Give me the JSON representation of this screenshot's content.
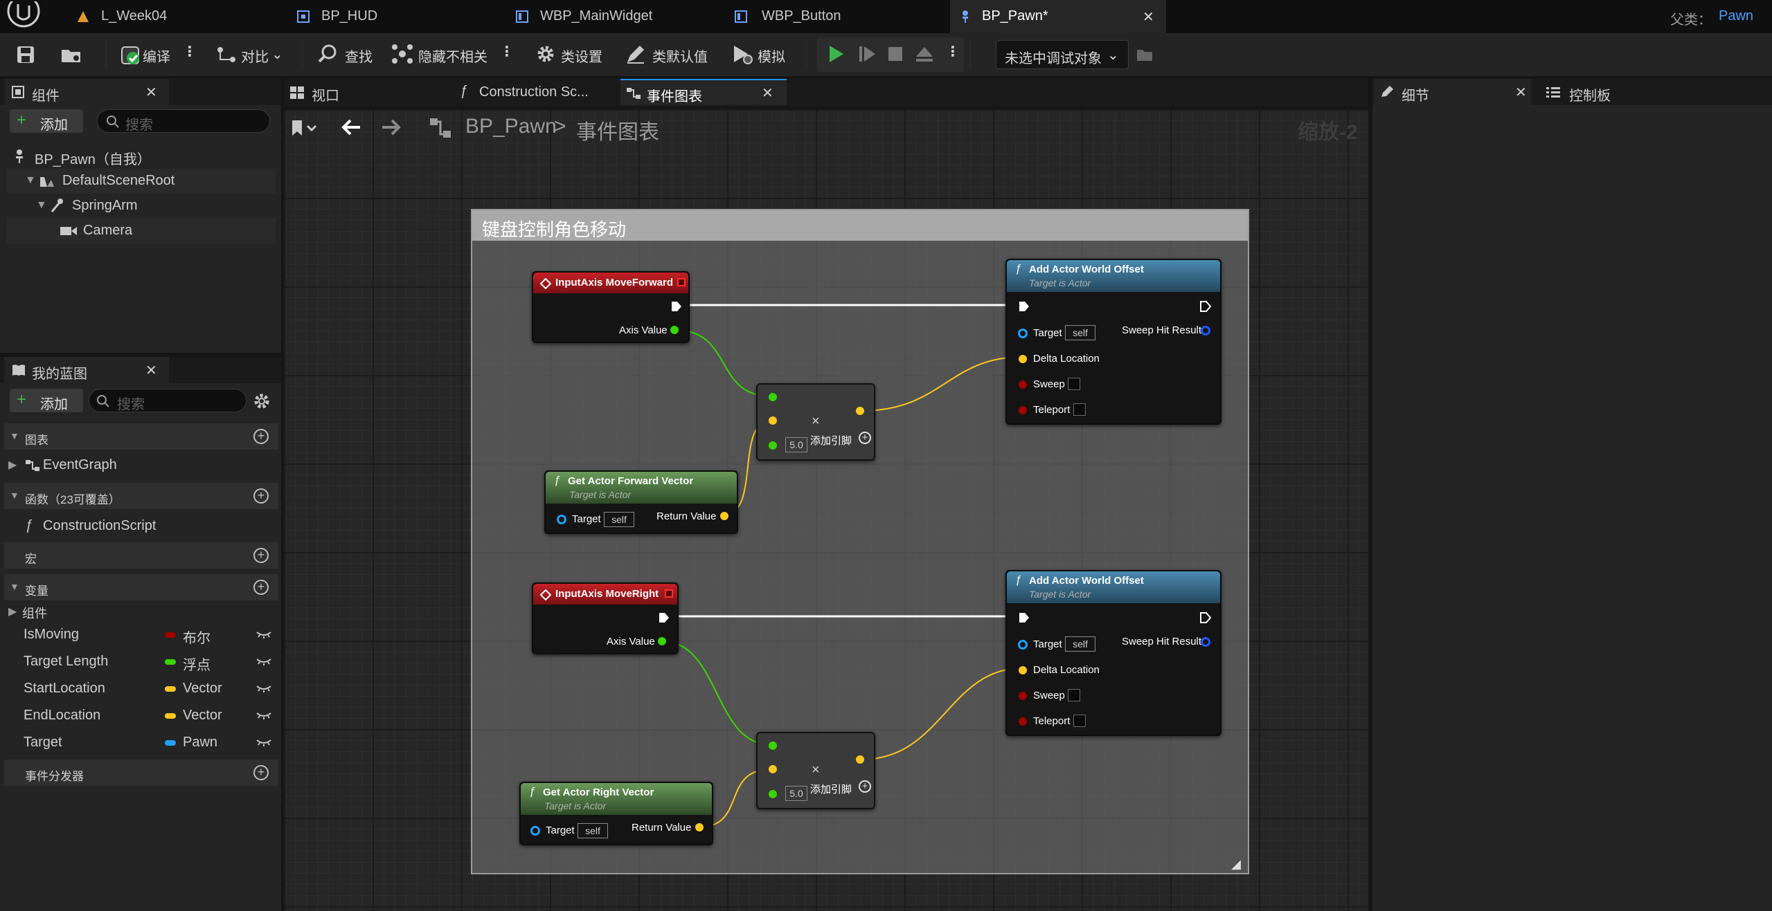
{
  "titlebar": {
    "tabs": [
      {
        "label": "L_Week04"
      },
      {
        "label": "BP_HUD"
      },
      {
        "label": "WBP_MainWidget"
      },
      {
        "label": "WBP_Button"
      },
      {
        "label": "BP_Pawn*"
      }
    ],
    "parent_label": "父类：",
    "parent_value": "Pawn"
  },
  "toolbar": {
    "compile": "编译",
    "diff": "对比",
    "find": "查找",
    "hide_unrelated": "隐藏不相关",
    "class_settings": "类设置",
    "class_defaults": "类默认值",
    "simulate": "模拟",
    "debug_target": "未选中调试对象"
  },
  "components_panel": {
    "tab": "组件",
    "add": "添加",
    "search_placeholder": "搜索",
    "tree": [
      {
        "label": "BP_Pawn（自我）"
      },
      {
        "label": "DefaultSceneRoot"
      },
      {
        "label": "SpringArm"
      },
      {
        "label": "Camera"
      }
    ]
  },
  "my_blueprint": {
    "tab": "我的蓝图",
    "add": "添加",
    "search_placeholder": "搜索",
    "sections": {
      "graphs": "图表",
      "event_graph": "EventGraph",
      "functions": "函数（23可覆盖）",
      "construction": "ConstructionScript",
      "macros": "宏",
      "variables": "变量",
      "components": "组件",
      "dispatchers": "事件分发器"
    },
    "variables": [
      {
        "name": "IsMoving",
        "type": "布尔",
        "color": "#a30000"
      },
      {
        "name": "Target Length",
        "type": "浮点",
        "color": "#38d500"
      },
      {
        "name": "StartLocation",
        "type": "Vector",
        "color": "#fdc81f"
      },
      {
        "name": "EndLocation",
        "type": "Vector",
        "color": "#fdc81f"
      },
      {
        "name": "Target",
        "type": "Pawn",
        "color": "#1ea0ff"
      }
    ]
  },
  "graph_tabs": {
    "viewport": "视口",
    "construction": "Construction Sc...",
    "event_graph": "事件图表"
  },
  "graph": {
    "breadcrumb_root": "BP_Pawn",
    "breadcrumb_sep": ">",
    "breadcrumb_current": "事件图表",
    "zoom": "缩放-2",
    "comment": "键盘控制角色移动",
    "add_pin": "添加引脚",
    "multiplier": "5.0",
    "input_forward": "InputAxis MoveForward",
    "input_right": "InputAxis MoveRight",
    "axis_value": "Axis Value",
    "add_offset": "Add Actor World Offset",
    "target_is_actor": "Target is Actor",
    "target": "Target",
    "self": "self",
    "sweep_hit": "Sweep Hit Result",
    "delta_location": "Delta Location",
    "sweep": "Sweep",
    "teleport": "Teleport",
    "forward_vector": "Get Actor Forward Vector",
    "right_vector": "Get Actor Right Vector",
    "return_value": "Return Value"
  },
  "right_panel": {
    "details": "细节",
    "palette": "控制板"
  },
  "colors": {
    "exec": "#ffffff",
    "float": "#38d500",
    "vector": "#fdc81f",
    "object": "#1ea0ff",
    "bool": "#a30000",
    "event_head": "#b3171c",
    "function_head": "#2f6e8f",
    "pure_head": "#4f7f44"
  }
}
